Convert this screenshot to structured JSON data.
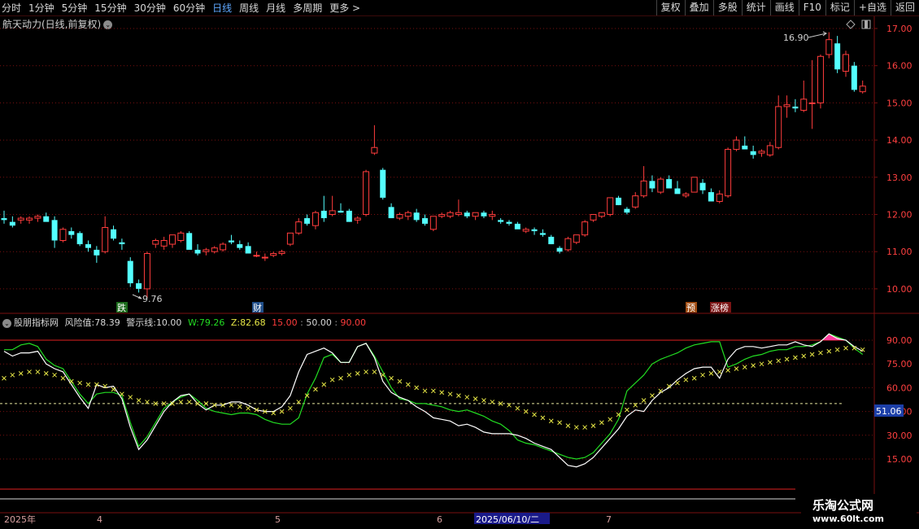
{
  "toolbar": {
    "periods": [
      "分时",
      "1分钟",
      "5分钟",
      "15分钟",
      "30分钟",
      "60分钟",
      "日线",
      "周线",
      "月线",
      "多周期",
      "更多 >"
    ],
    "active_period": "日线",
    "buttons": [
      "复权",
      "叠加",
      "多股",
      "统计",
      "画线",
      "F10",
      "标记",
      "+自选",
      "返回"
    ]
  },
  "main": {
    "title": "航天动力(日线,前复权)",
    "high_label": "16.90",
    "low_label": "9.76",
    "markers": [
      "跌",
      "财",
      "预",
      "涨榜"
    ],
    "price_ticks": [
      "17.00",
      "16.00",
      "15.00",
      "14.00",
      "13.00",
      "12.00",
      "11.00",
      "10.00"
    ]
  },
  "indicator": {
    "name": "股朋指标网",
    "risk_label": "风险值:",
    "risk_value": "78.39",
    "warn_label": "警示线:",
    "warn_value": "10.00",
    "w_label": "W:",
    "w_value": "79.26",
    "z_label": "Z:",
    "z_value": "82.68",
    "level_low": "15.00",
    "level_mid": "50.00",
    "level_high": "90.00",
    "ticks": [
      "90.00",
      "75.00",
      "60.00",
      "45.00",
      "30.00",
      "15.00"
    ],
    "current_badge": "51.06"
  },
  "date_axis": {
    "year": "2025年",
    "months": [
      "4",
      "5",
      "6",
      "7"
    ],
    "cursor_date": "2025/06/10/二"
  },
  "watermark": {
    "line1": "乐淘公式网",
    "line2": "www.60lt.com"
  },
  "colors": {
    "up": "#ff3c3c",
    "down": "#54ffff",
    "grid": "#7a1010",
    "w_line": "#ffffff",
    "z_line": "#22dd22",
    "cross": "#e6e646",
    "pink": "#ff3c9c"
  },
  "chart_data": [
    {
      "type": "candlestick",
      "title": "航天动力(日线,前复权)",
      "y_ticks": [
        10,
        11,
        12,
        13,
        14,
        15,
        16,
        17
      ],
      "ylim": [
        9.5,
        17.3
      ],
      "x_labels": [
        "2025年",
        "4",
        "5",
        "6",
        "7"
      ],
      "ohlc": [
        [
          11.9,
          12.1,
          11.75,
          11.85
        ],
        [
          11.8,
          11.95,
          11.65,
          11.7
        ],
        [
          11.85,
          11.95,
          11.75,
          11.9
        ],
        [
          11.85,
          11.95,
          11.75,
          11.9
        ],
        [
          11.9,
          12.0,
          11.8,
          11.95
        ],
        [
          11.95,
          12.05,
          11.85,
          11.8
        ],
        [
          11.85,
          11.95,
          11.1,
          11.3
        ],
        [
          11.3,
          11.65,
          11.25,
          11.6
        ],
        [
          11.55,
          11.65,
          11.35,
          11.45
        ],
        [
          11.5,
          11.55,
          11.15,
          11.2
        ],
        [
          11.2,
          11.3,
          11.0,
          11.1
        ],
        [
          11.05,
          11.15,
          10.7,
          10.9
        ],
        [
          11.0,
          11.95,
          10.95,
          11.65
        ],
        [
          11.6,
          11.7,
          11.3,
          11.35
        ],
        [
          11.25,
          11.35,
          11.05,
          11.2
        ],
        [
          10.75,
          10.85,
          10.05,
          10.15
        ],
        [
          10.15,
          10.25,
          9.9,
          10.0
        ],
        [
          10.0,
          11.0,
          9.76,
          10.95
        ],
        [
          11.2,
          11.35,
          11.1,
          11.3
        ],
        [
          11.15,
          11.4,
          11.05,
          11.3
        ],
        [
          11.2,
          11.45,
          11.1,
          11.45
        ],
        [
          11.3,
          11.55,
          11.25,
          11.5
        ],
        [
          11.5,
          11.55,
          11.1,
          11.05
        ],
        [
          11.05,
          11.2,
          10.9,
          10.95
        ],
        [
          11.0,
          11.1,
          10.9,
          11.05
        ],
        [
          11.0,
          11.15,
          10.95,
          11.1
        ],
        [
          11.05,
          11.25,
          11.0,
          11.2
        ],
        [
          11.3,
          11.45,
          11.2,
          11.25
        ],
        [
          11.2,
          11.3,
          11.05,
          11.1
        ],
        [
          11.15,
          11.25,
          10.95,
          10.95
        ],
        [
          10.9,
          11.0,
          10.85,
          10.9
        ],
        [
          10.85,
          10.95,
          10.75,
          10.85
        ],
        [
          10.9,
          11.0,
          10.85,
          10.95
        ],
        [
          10.95,
          11.05,
          10.9,
          11.0
        ],
        [
          11.2,
          11.5,
          11.15,
          11.5
        ],
        [
          11.5,
          11.9,
          11.45,
          11.8
        ],
        [
          11.9,
          12.0,
          11.7,
          11.75
        ],
        [
          11.7,
          12.1,
          11.6,
          12.05
        ],
        [
          12.1,
          12.5,
          11.8,
          11.9
        ],
        [
          12.0,
          12.5,
          11.95,
          12.1
        ],
        [
          12.1,
          12.3,
          12.05,
          12.05
        ],
        [
          12.1,
          12.15,
          11.8,
          11.8
        ],
        [
          11.85,
          11.95,
          11.75,
          11.9
        ],
        [
          12.0,
          13.2,
          11.95,
          13.15
        ],
        [
          13.65,
          14.4,
          13.6,
          13.8
        ],
        [
          13.2,
          13.25,
          12.4,
          12.45
        ],
        [
          12.2,
          12.3,
          11.9,
          11.9
        ],
        [
          11.9,
          12.05,
          11.85,
          12.0
        ],
        [
          11.95,
          12.1,
          11.85,
          12.05
        ],
        [
          12.05,
          12.15,
          11.8,
          11.85
        ],
        [
          11.9,
          12.0,
          11.7,
          11.75
        ],
        [
          11.6,
          11.95,
          11.55,
          11.95
        ],
        [
          11.95,
          12.05,
          11.9,
          12.0
        ],
        [
          11.95,
          12.1,
          11.9,
          12.05
        ],
        [
          12.0,
          12.4,
          11.95,
          12.05
        ],
        [
          12.05,
          12.1,
          11.9,
          11.95
        ],
        [
          11.95,
          12.05,
          11.85,
          12.05
        ],
        [
          12.05,
          12.1,
          11.9,
          11.95
        ],
        [
          11.95,
          12.1,
          11.85,
          12.0
        ],
        [
          11.85,
          11.9,
          11.75,
          11.8
        ],
        [
          11.8,
          11.85,
          11.7,
          11.75
        ],
        [
          11.75,
          11.8,
          11.65,
          11.6
        ],
        [
          11.55,
          11.65,
          11.5,
          11.6
        ],
        [
          11.6,
          11.65,
          11.45,
          11.55
        ],
        [
          11.5,
          11.6,
          11.4,
          11.45
        ],
        [
          11.4,
          11.45,
          11.2,
          11.2
        ],
        [
          11.1,
          11.15,
          10.95,
          11.0
        ],
        [
          11.05,
          11.4,
          11.0,
          11.35
        ],
        [
          11.25,
          11.45,
          11.2,
          11.45
        ],
        [
          11.45,
          11.85,
          11.4,
          11.8
        ],
        [
          11.85,
          12.0,
          11.8,
          12.0
        ],
        [
          11.95,
          12.05,
          11.9,
          12.05
        ],
        [
          12.0,
          12.45,
          11.95,
          12.45
        ],
        [
          12.45,
          12.5,
          12.25,
          12.25
        ],
        [
          12.15,
          12.2,
          12.0,
          12.05
        ],
        [
          12.2,
          12.6,
          12.15,
          12.5
        ],
        [
          12.5,
          13.3,
          12.45,
          12.9
        ],
        [
          12.9,
          13.05,
          12.6,
          12.7
        ],
        [
          12.6,
          13.0,
          12.55,
          12.95
        ],
        [
          12.95,
          13.05,
          12.7,
          12.7
        ],
        [
          12.7,
          12.9,
          12.6,
          12.55
        ],
        [
          12.5,
          12.6,
          12.45,
          12.55
        ],
        [
          12.6,
          13.0,
          12.6,
          13.0
        ],
        [
          12.85,
          12.95,
          12.55,
          12.65
        ],
        [
          12.6,
          12.7,
          12.35,
          12.35
        ],
        [
          12.35,
          12.65,
          12.3,
          12.55
        ],
        [
          12.5,
          13.8,
          12.45,
          13.75
        ],
        [
          13.75,
          14.1,
          13.7,
          14.0
        ],
        [
          13.85,
          14.1,
          13.75,
          13.75
        ],
        [
          13.7,
          13.85,
          13.5,
          13.6
        ],
        [
          13.65,
          13.75,
          13.55,
          13.7
        ],
        [
          13.6,
          13.95,
          13.55,
          13.85
        ],
        [
          13.8,
          15.2,
          13.75,
          14.9
        ],
        [
          14.9,
          15.2,
          14.6,
          14.95
        ],
        [
          14.9,
          15.1,
          14.75,
          14.85
        ],
        [
          14.8,
          15.6,
          14.75,
          15.1
        ],
        [
          15.0,
          16.15,
          14.3,
          15.0
        ],
        [
          15.0,
          16.3,
          14.85,
          16.25
        ],
        [
          16.3,
          16.9,
          16.2,
          16.7
        ],
        [
          16.6,
          16.8,
          15.8,
          15.9
        ],
        [
          15.85,
          16.4,
          15.7,
          16.3
        ],
        [
          16.0,
          16.1,
          15.3,
          15.35
        ],
        [
          15.3,
          15.6,
          15.25,
          15.45
        ]
      ]
    },
    {
      "type": "line",
      "title": "股朋指标网",
      "y_ticks": [
        15,
        30,
        45,
        60,
        75,
        90
      ],
      "ylim": [
        9,
        97
      ],
      "reference_lines": [
        15,
        50,
        90
      ],
      "series": [
        {
          "name": "W",
          "values": [
            83,
            80,
            82,
            82,
            83,
            75,
            72,
            70,
            62,
            54,
            47,
            62,
            60,
            61,
            53,
            35,
            21,
            27,
            36,
            45,
            51,
            55,
            56,
            50,
            46,
            49,
            49,
            51,
            51,
            49,
            46,
            45,
            45,
            48,
            55,
            70,
            81,
            83,
            85,
            82,
            76,
            76,
            86,
            88,
            79,
            64,
            57,
            54,
            52,
            48,
            45,
            41,
            40,
            39,
            36,
            37,
            35,
            32,
            31,
            31,
            31,
            30,
            28,
            25,
            23,
            21,
            16,
            11,
            10,
            12,
            16,
            22,
            28,
            34,
            42,
            46,
            45,
            52,
            57,
            60,
            65,
            69,
            72,
            73,
            73,
            66,
            78,
            84,
            86,
            86,
            85,
            86,
            87,
            87,
            89,
            87,
            86,
            89,
            94,
            91,
            90,
            86,
            83
          ]
        },
        {
          "name": "Z",
          "values": [
            84,
            84,
            87,
            88,
            86,
            78,
            74,
            72,
            64,
            56,
            50,
            56,
            57,
            57,
            55,
            38,
            23,
            29,
            38,
            47,
            51,
            54,
            56,
            52,
            47,
            45,
            44,
            43,
            44,
            44,
            43,
            40,
            38,
            37,
            37,
            41,
            56,
            66,
            79,
            81,
            76,
            76,
            86,
            88,
            80,
            70,
            60,
            53,
            52,
            50,
            50,
            49,
            48,
            46,
            45,
            46,
            44,
            42,
            39,
            37,
            33,
            27,
            25,
            24,
            22,
            20,
            18,
            16,
            15,
            16,
            19,
            25,
            31,
            40,
            58,
            63,
            68,
            75,
            78,
            80,
            82,
            85,
            87,
            88,
            89,
            89,
            73,
            75,
            78,
            80,
            81,
            83,
            84,
            84,
            86,
            86,
            87,
            89,
            94,
            92,
            90,
            85,
            81
          ]
        },
        {
          "name": "X",
          "values": [
            66,
            68,
            69,
            70,
            70,
            69,
            68,
            66,
            64,
            63,
            62,
            62,
            61,
            59,
            56,
            54,
            52,
            51,
            50,
            50,
            50,
            51,
            51,
            50,
            50,
            49,
            49,
            49,
            48,
            47,
            46,
            45,
            44,
            45,
            47,
            51,
            55,
            59,
            62,
            65,
            66,
            68,
            69,
            70,
            70,
            68,
            66,
            64,
            62,
            60,
            58,
            58,
            57,
            56,
            55,
            54,
            53,
            52,
            51,
            50,
            49,
            47,
            45,
            43,
            41,
            39,
            38,
            36,
            35,
            35,
            36,
            38,
            40,
            43,
            46,
            49,
            52,
            55,
            58,
            61,
            63,
            65,
            66,
            68,
            69,
            70,
            71,
            72,
            73,
            74,
            75,
            76,
            77,
            78,
            79,
            80,
            81,
            82,
            83,
            84,
            85,
            85,
            84
          ]
        }
      ]
    }
  ]
}
